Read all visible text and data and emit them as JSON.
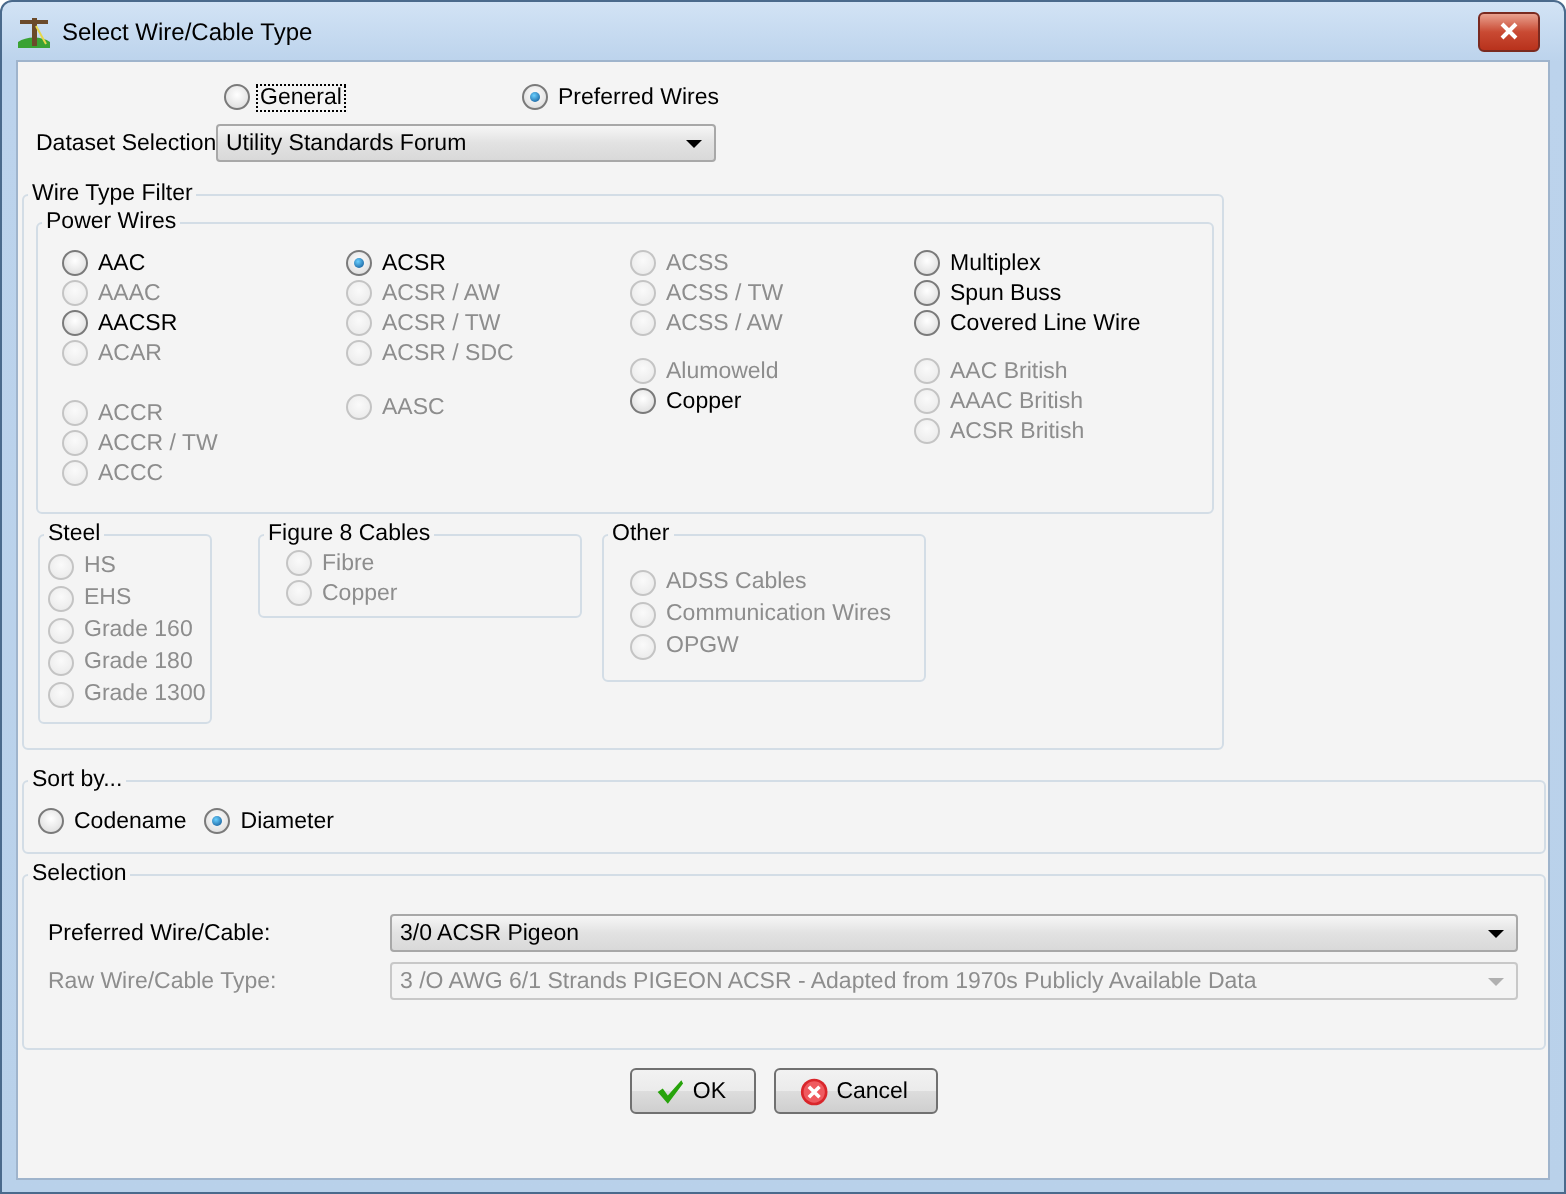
{
  "window": {
    "title": "Select Wire/Cable Type"
  },
  "mode_options": [
    {
      "label": "General",
      "selected": false,
      "focused": true
    },
    {
      "label": "Preferred Wires",
      "selected": true,
      "focused": false
    }
  ],
  "dataset_selection": {
    "label": "Dataset Selection",
    "value": "Utility Standards Forum"
  },
  "wire_type_filter": {
    "title": "Wire Type Filter",
    "power_wires": {
      "title": "Power Wires",
      "columns": [
        {
          "groups": [
            {
              "items": [
                {
                  "label": "AAC",
                  "selected": false,
                  "disabled": false
                },
                {
                  "label": "AAAC",
                  "selected": false,
                  "disabled": true
                },
                {
                  "label": "AACSR",
                  "selected": false,
                  "disabled": false
                },
                {
                  "label": "ACAR",
                  "selected": false,
                  "disabled": true
                }
              ]
            },
            {
              "items": [
                {
                  "label": "ACCR",
                  "selected": false,
                  "disabled": true
                },
                {
                  "label": "ACCR / TW",
                  "selected": false,
                  "disabled": true
                },
                {
                  "label": "ACCC",
                  "selected": false,
                  "disabled": true
                }
              ]
            }
          ]
        },
        {
          "groups": [
            {
              "items": [
                {
                  "label": "ACSR",
                  "selected": true,
                  "disabled": false
                },
                {
                  "label": "ACSR / AW",
                  "selected": false,
                  "disabled": true
                },
                {
                  "label": "ACSR / TW",
                  "selected": false,
                  "disabled": true
                },
                {
                  "label": "ACSR / SDC",
                  "selected": false,
                  "disabled": true
                }
              ]
            },
            {
              "items": [
                {
                  "label": "AASC",
                  "selected": false,
                  "disabled": true
                }
              ]
            }
          ]
        },
        {
          "groups": [
            {
              "items": [
                {
                  "label": "ACSS",
                  "selected": false,
                  "disabled": true
                },
                {
                  "label": "ACSS / TW",
                  "selected": false,
                  "disabled": true
                },
                {
                  "label": "ACSS / AW",
                  "selected": false,
                  "disabled": true
                }
              ]
            },
            {
              "items": [
                {
                  "label": "Alumoweld",
                  "selected": false,
                  "disabled": true
                },
                {
                  "label": "Copper",
                  "selected": false,
                  "disabled": false
                }
              ]
            }
          ]
        },
        {
          "groups": [
            {
              "items": [
                {
                  "label": "Multiplex",
                  "selected": false,
                  "disabled": false
                },
                {
                  "label": "Spun Buss",
                  "selected": false,
                  "disabled": false
                },
                {
                  "label": "Covered Line Wire",
                  "selected": false,
                  "disabled": false
                }
              ]
            },
            {
              "items": [
                {
                  "label": "AAC British",
                  "selected": false,
                  "disabled": true
                },
                {
                  "label": "AAAC British",
                  "selected": false,
                  "disabled": true
                },
                {
                  "label": "ACSR British",
                  "selected": false,
                  "disabled": true
                }
              ]
            }
          ]
        }
      ]
    },
    "steel": {
      "title": "Steel",
      "items": [
        {
          "label": "HS",
          "selected": false,
          "disabled": true
        },
        {
          "label": "EHS",
          "selected": false,
          "disabled": true
        },
        {
          "label": "Grade 160",
          "selected": false,
          "disabled": true
        },
        {
          "label": "Grade 180",
          "selected": false,
          "disabled": true
        },
        {
          "label": "Grade 1300",
          "selected": false,
          "disabled": true
        }
      ]
    },
    "figure_8_cables": {
      "title": "Figure 8 Cables",
      "items": [
        {
          "label": "Fibre",
          "selected": false,
          "disabled": true
        },
        {
          "label": "Copper",
          "selected": false,
          "disabled": true
        }
      ]
    },
    "other": {
      "title": "Other",
      "items": [
        {
          "label": "ADSS Cables",
          "selected": false,
          "disabled": true
        },
        {
          "label": "Communication Wires",
          "selected": false,
          "disabled": true
        },
        {
          "label": "OPGW",
          "selected": false,
          "disabled": true
        }
      ]
    }
  },
  "sort_by": {
    "title": "Sort by...",
    "options": [
      {
        "label": "Codename",
        "selected": false
      },
      {
        "label": "Diameter",
        "selected": true
      }
    ]
  },
  "selection": {
    "title": "Selection",
    "fields": [
      {
        "label": "Preferred Wire/Cable:",
        "value": "3/0 ACSR Pigeon",
        "disabled": false
      },
      {
        "label": "Raw Wire/Cable Type:",
        "value": "3 /O AWG 6/1 Strands PIGEON ACSR - Adapted from 1970s Publicly Available Data",
        "disabled": true
      }
    ]
  },
  "buttons": [
    {
      "label": "OK",
      "kind": "ok"
    },
    {
      "label": "Cancel",
      "kind": "cancel"
    }
  ]
}
